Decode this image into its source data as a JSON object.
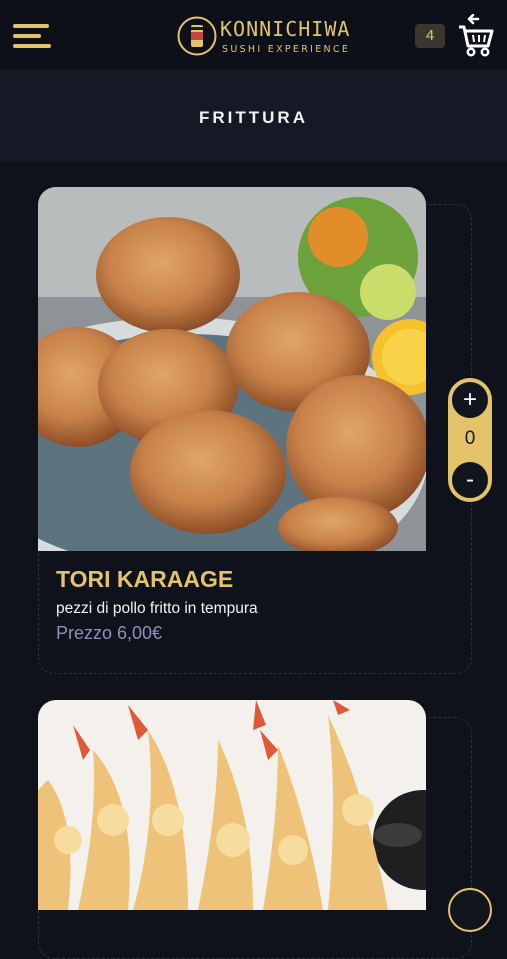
{
  "header": {
    "brand": "KONNICHIWA",
    "tagline": "SUSHI EXPERIENCE",
    "cart_count": "4",
    "menu_icon": "hamburger-menu-icon",
    "cart_icon": "shopping-cart-back-icon",
    "accent_color": "#e3c36a"
  },
  "section": {
    "title": "FRITTURA"
  },
  "items": [
    {
      "name": "TORI KARAAGE",
      "description": "pezzi di pollo fritto in tempura",
      "price": "Prezzo 6,00€",
      "quantity": "0",
      "plus_label": "+",
      "minus_label": "-",
      "image": "fried-chicken-photo"
    },
    {
      "image": "tempura-shrimp-photo"
    }
  ]
}
